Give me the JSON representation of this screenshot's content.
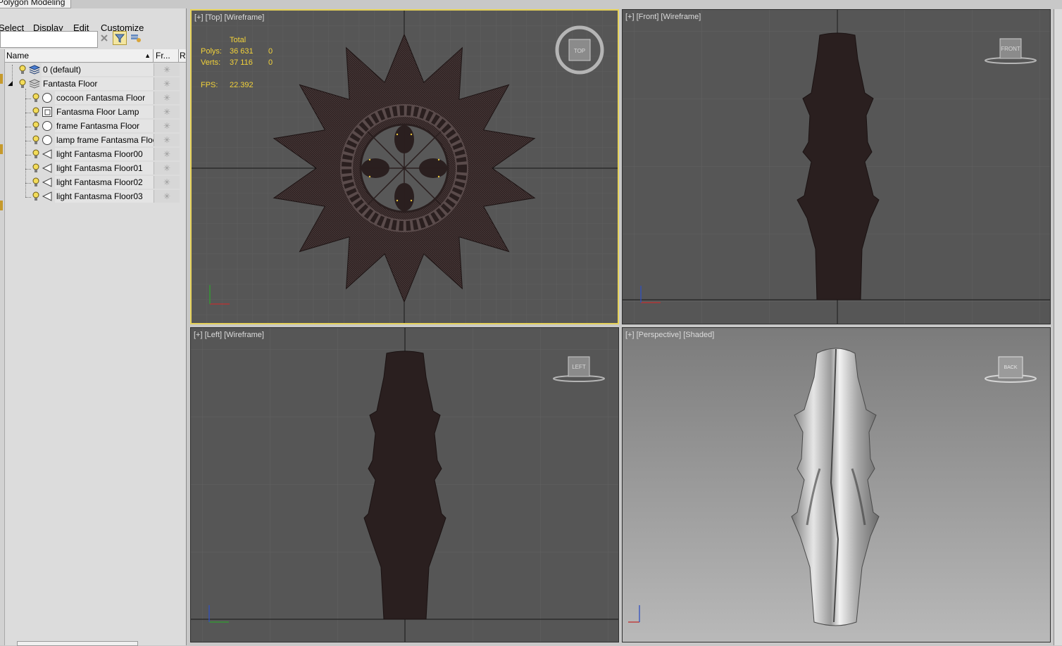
{
  "ribbon": {
    "tab_label": "Polygon Modeling"
  },
  "menu": {
    "items": [
      "Select",
      "Display",
      "Edit",
      "Customize"
    ]
  },
  "search": {
    "value": "",
    "placeholder": ""
  },
  "columns": {
    "name": "Name",
    "frozen": "Fr...",
    "render": "R"
  },
  "layers": [
    {
      "label": "0 (default)",
      "kind": "layer",
      "level": 0
    },
    {
      "label": "Fantasta Floor",
      "kind": "layer",
      "level": 0,
      "expanded": true
    },
    {
      "label": "cocoon Fantasma Floor",
      "kind": "sphere",
      "level": 1
    },
    {
      "label": "Fantasma Floor Lamp",
      "kind": "group",
      "level": 1
    },
    {
      "label": "frame Fantasma Floor",
      "kind": "sphere",
      "level": 1
    },
    {
      "label": "lamp frame Fantasma Floor",
      "kind": "sphere",
      "level": 1
    },
    {
      "label": "light Fantasma Floor00",
      "kind": "light",
      "level": 1
    },
    {
      "label": "light Fantasma Floor01",
      "kind": "light",
      "level": 1
    },
    {
      "label": "light Fantasma Floor02",
      "kind": "light",
      "level": 1
    },
    {
      "label": "light Fantasma Floor03",
      "kind": "light",
      "level": 1
    }
  ],
  "viewports": {
    "top": {
      "label": "[+] [Top] [Wireframe]",
      "cube": "TOP"
    },
    "front": {
      "label": "[+] [Front] [Wireframe]",
      "cube": "FRONT"
    },
    "left": {
      "label": "[+] [Left] [Wireframe]",
      "cube": "LEFT"
    },
    "perspective": {
      "label": "[+] [Perspective] [Shaded]",
      "cube": "BACK"
    }
  },
  "stats": {
    "total_label": "Total",
    "polys_label": "Polys:",
    "polys_value": "36 631",
    "polys_sel": "0",
    "verts_label": "Verts:",
    "verts_value": "37 116",
    "verts_sel": "0",
    "fps_label": "FPS:",
    "fps_value": "22.392"
  },
  "colors": {
    "active_viewport": "#e6d25a",
    "stats": "#f2d23a",
    "mesh": "#2a1f1f",
    "viewport_bg": "#565656"
  }
}
